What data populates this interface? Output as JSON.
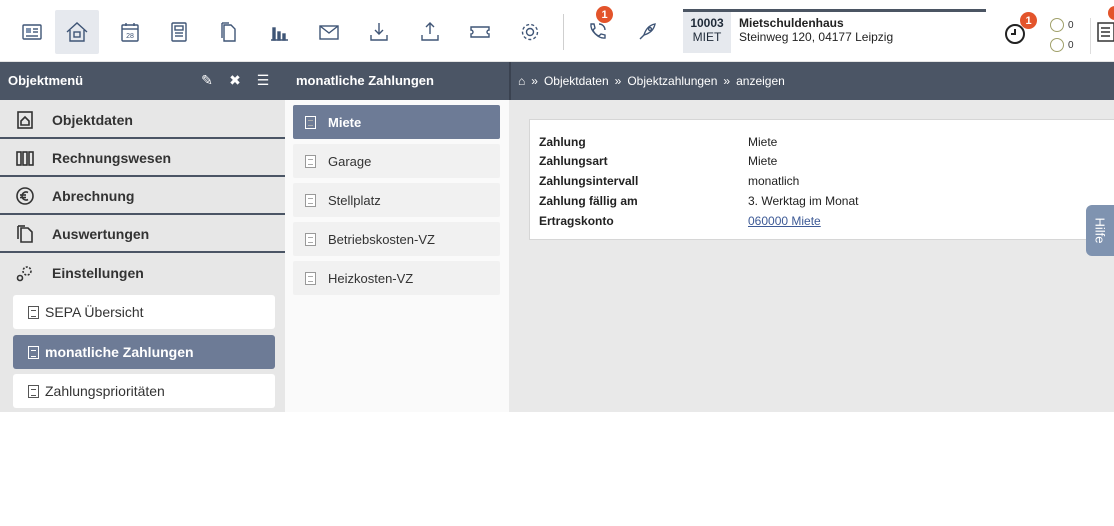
{
  "toolbar": {
    "buttons": [
      {
        "name": "contact-card-icon"
      },
      {
        "name": "home-icon"
      },
      {
        "name": "calendar-icon",
        "label": "28"
      },
      {
        "name": "calculator-icon"
      },
      {
        "name": "documents-icon"
      },
      {
        "name": "bar-chart-icon"
      },
      {
        "name": "mail-icon"
      },
      {
        "name": "download-icon"
      },
      {
        "name": "upload-icon"
      },
      {
        "name": "ticket-icon"
      },
      {
        "name": "gear-icon"
      },
      {
        "name": "phone-icon",
        "badge": "1"
      },
      {
        "name": "rocket-icon"
      }
    ],
    "badge_color": "#e3542b"
  },
  "object": {
    "number": "10003",
    "code": "MIET",
    "title": "Mietschuldenhaus",
    "address": "Steinweg 120, 04177 Leipzig"
  },
  "right_tools": {
    "clock_badge": "1",
    "counter_1": "0",
    "counter_2": "0"
  },
  "header": {
    "objektmenu": "Objektmenü",
    "section_title": "monatliche Zahlungen",
    "breadcrumb": [
      "»",
      "Objektdaten",
      "»",
      "Objektzahlungen",
      "»",
      "anzeigen"
    ]
  },
  "sidebar": {
    "items": [
      {
        "label": "Objektdaten",
        "icon": "house-doc-icon"
      },
      {
        "label": "Rechnungswesen",
        "icon": "ledger-icon"
      },
      {
        "label": "Abrechnung",
        "icon": "euro-icon"
      },
      {
        "label": "Auswertungen",
        "icon": "pages-icon"
      },
      {
        "label": "Einstellungen",
        "icon": "gears-icon"
      }
    ],
    "subitems": [
      {
        "label": "SEPA Übersicht",
        "active": false
      },
      {
        "label": "monatliche Zahlungen",
        "active": true
      },
      {
        "label": "Zahlungsprioritäten",
        "active": false
      }
    ]
  },
  "payments": {
    "items": [
      {
        "label": "Miete",
        "active": true
      },
      {
        "label": "Garage",
        "active": false
      },
      {
        "label": "Stellplatz",
        "active": false
      },
      {
        "label": "Betriebskosten-VZ",
        "active": false
      },
      {
        "label": "Heizkosten-VZ",
        "active": false
      }
    ]
  },
  "detail": {
    "rows": [
      {
        "key": "Zahlung",
        "value": "Miete"
      },
      {
        "key": "Zahlungsart",
        "value": "Miete"
      },
      {
        "key": "Zahlungsintervall",
        "value": "monatlich"
      },
      {
        "key": "Zahlung fällig am",
        "value": "3. Werktag im Monat"
      },
      {
        "key": "Ertragskonto",
        "value": "060000 Miete"
      }
    ]
  },
  "help": {
    "label": "Hilfe"
  },
  "colors": {
    "header_bar": "#4b5565",
    "active_item": "#6d7b96",
    "help_tab": "#7f93b0"
  }
}
